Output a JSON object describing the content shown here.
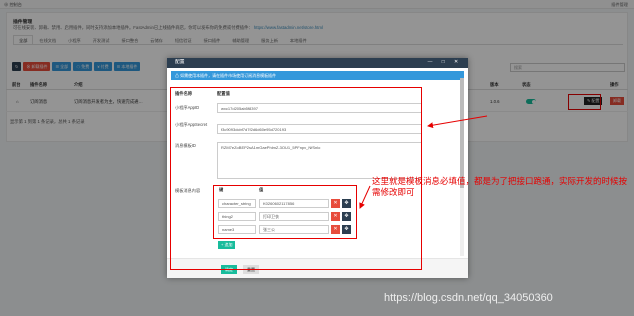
{
  "topbar": {
    "crumb": "⊕ 控制台",
    "right": "插件管理"
  },
  "page": {
    "title": "插件管理",
    "desc_text": "可在线安装、卸载、禁用、启用插件，同时支持添加本地插件。FastAdmin已上线插件商店，你可以发布你的免费或付费插件：",
    "desc_link": "https://www.fastadmin.net/store.html"
  },
  "tabs": [
    "全部",
    "在线文档",
    "小程序",
    "开发测试",
    "接口整合",
    "云储存",
    "短信验证",
    "接口插件",
    "辅助管理",
    "服务上新",
    "本地插件"
  ],
  "toolbar": {
    "refresh": "↻",
    "uninstall": "⊗ 卸载插件",
    "all": "☰ 全部",
    "free": "☁ 免费",
    "paid": "¥ 付费",
    "local": "☰ 本地插件"
  },
  "search_placeholder": "搜索",
  "table": {
    "headers": [
      "前台",
      "插件名称",
      "介绍",
      "版本",
      "状态",
      "操作"
    ],
    "row": {
      "icon": "⌂",
      "name": "订阅消息",
      "intro": "订阅消息开发者为主，快速完成通…",
      "version": "1.0.6",
      "config": "✎ 配置",
      "uninstall": "卸载"
    }
  },
  "footer_info": "显示第 1 到第 1 条记录，总共 1 条记录",
  "modal": {
    "title": "配置",
    "controls": "— □ ✕",
    "alert": "⚠ 如需使用本插件，请在插件市场使用订阅消息模板插件",
    "col_name": "插件名称",
    "col_value": "配置值",
    "fields": [
      {
        "label": "小程序AppID",
        "value": "wxc17d205ab5f8397"
      },
      {
        "label": "小程序AppSecret",
        "value": "f3c9093dcbf7d7f2d6d60e95d720193"
      },
      {
        "label": "消息模板ID",
        "value": "RZM7eZoBEP2sA1mGaePhlmZ-3OU1_5PFnpv_NfSnlo"
      }
    ],
    "template_label": "模板消息内容",
    "kv_key_header": "键",
    "kv_value_header": "值",
    "kv_rows": [
      {
        "key": "character_string",
        "value": "K0260602117856"
      },
      {
        "key": "thing2",
        "value": "打印卫衣"
      },
      {
        "key": "name3",
        "value": "张三公"
      }
    ],
    "add_label": "+ 追加",
    "ok_label": "确定",
    "reset_label": "重置"
  },
  "annotation": "这里就是模板消息必填值，都是为了把接口跑通，实际开发的时候按需修改即可",
  "watermark": "https://blog.csdn.net/qq_34050360",
  "colors": {
    "header": "#2c3e50",
    "success": "#18bc9c",
    "danger": "#e74c3c",
    "info": "#3498db",
    "annotation": "#e60000"
  }
}
